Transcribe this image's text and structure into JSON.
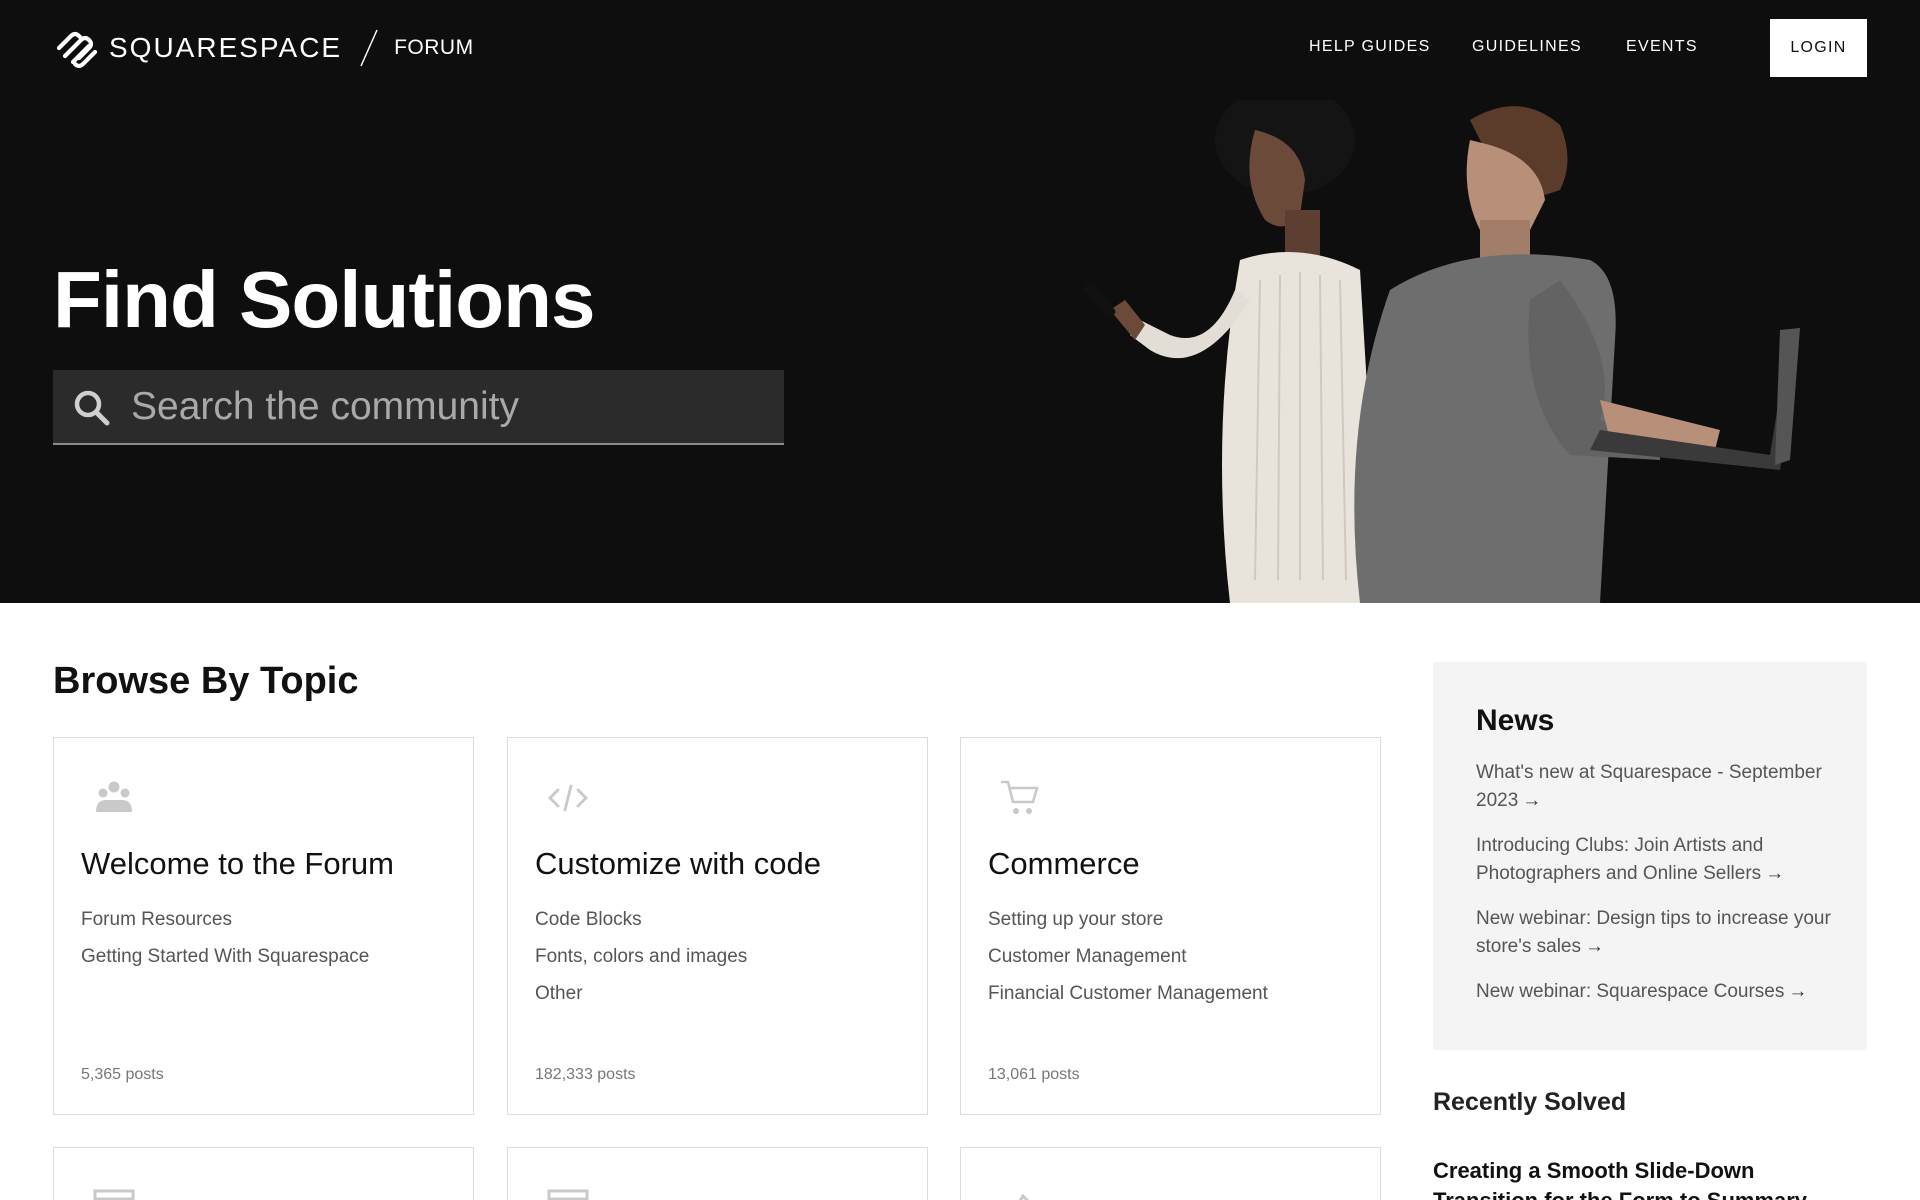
{
  "brand": {
    "name": "SQUARESPACE",
    "section": "FORUM"
  },
  "nav": {
    "help_guides": "HELP GUIDES",
    "guidelines": "GUIDELINES",
    "events": "EVENTS",
    "login": "LOGIN"
  },
  "hero": {
    "title": "Find Solutions",
    "search_placeholder": "Search the community"
  },
  "browse": {
    "title": "Browse By Topic",
    "cards": [
      {
        "icon": "community-icon",
        "title": "Welcome to the Forum",
        "links": [
          "Forum Resources",
          "Getting Started With Squarespace"
        ],
        "count": "5,365 posts"
      },
      {
        "icon": "code-icon",
        "title": "Customize with code",
        "links": [
          "Code Blocks",
          "Fonts, colors and images",
          "Other"
        ],
        "count": "182,333 posts"
      },
      {
        "icon": "cart-icon",
        "title": "Commerce",
        "links": [
          "Setting up your store",
          "Customer Management",
          "Financial Customer Management"
        ],
        "count": "13,061 posts"
      }
    ]
  },
  "news": {
    "title": "News",
    "items": [
      "What's new at Squarespace - September 2023",
      "Introducing Clubs: Join Artists and Photographers and Online Sellers",
      "New webinar: Design tips to increase your store's sales",
      "New webinar: Squarespace Courses"
    ]
  },
  "recently_solved": {
    "title": "Recently Solved",
    "items": [
      "Creating a Smooth Slide-Down Transition for the Form to Summary"
    ]
  },
  "colors": {
    "hero_bg": "#0e0e0e",
    "panel_bg": "#f4f4f4",
    "text_muted": "#555555"
  }
}
